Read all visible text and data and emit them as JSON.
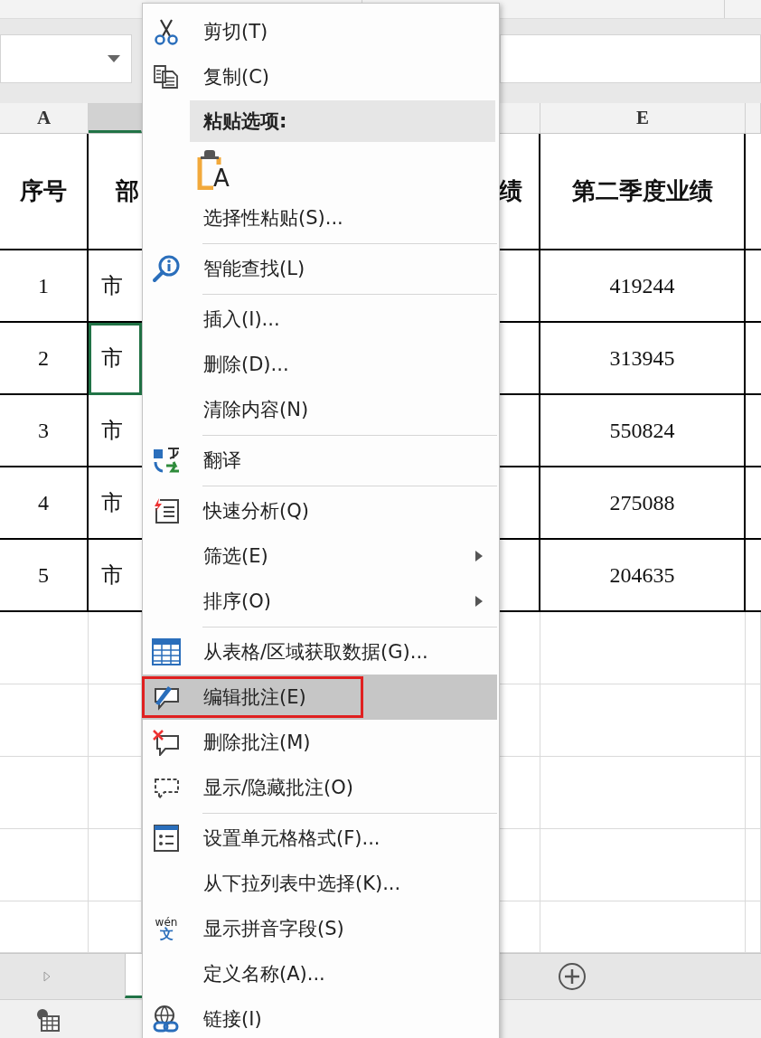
{
  "sheet": {
    "columns": [
      {
        "label": "A",
        "selected": false
      },
      {
        "selected": true
      },
      {
        "selected": false
      },
      {
        "label": "E",
        "selected": false
      },
      {
        "selected": false
      }
    ],
    "header_row": {
      "a": "序号",
      "b": "部",
      "d": "绩",
      "e": "第二季度业绩"
    },
    "rows": [
      {
        "a": "1",
        "b": "市",
        "e": "419244",
        "selected": false
      },
      {
        "a": "2",
        "b": "市",
        "e": "313945",
        "selected": true
      },
      {
        "a": "3",
        "b": "市",
        "e": "550824",
        "selected": false
      },
      {
        "a": "4",
        "b": "市",
        "e": "275088",
        "selected": false
      },
      {
        "a": "5",
        "b": "市",
        "e": "204635",
        "selected": false
      }
    ]
  },
  "context_menu": {
    "items": [
      {
        "kind": "item",
        "label": "剪切(T)",
        "submenu": false,
        "selected": false,
        "outlined": false
      },
      {
        "kind": "item",
        "label": "复制(C)",
        "submenu": false,
        "selected": false,
        "outlined": false
      },
      {
        "kind": "header",
        "label": "粘贴选项:"
      },
      {
        "kind": "paste-options",
        "glyph": "A"
      },
      {
        "kind": "item",
        "label": "选择性粘贴(S)...",
        "submenu": false,
        "selected": false,
        "outlined": false
      },
      {
        "kind": "separator"
      },
      {
        "kind": "item",
        "label": "智能查找(L)",
        "submenu": false,
        "selected": false,
        "outlined": false
      },
      {
        "kind": "separator"
      },
      {
        "kind": "item",
        "label": "插入(I)...",
        "submenu": false,
        "selected": false,
        "outlined": false
      },
      {
        "kind": "item",
        "label": "删除(D)...",
        "submenu": false,
        "selected": false,
        "outlined": false
      },
      {
        "kind": "item",
        "label": "清除内容(N)",
        "submenu": false,
        "selected": false,
        "outlined": false
      },
      {
        "kind": "separator"
      },
      {
        "kind": "item",
        "label": "翻译",
        "submenu": false,
        "selected": false,
        "outlined": false
      },
      {
        "kind": "separator"
      },
      {
        "kind": "item",
        "label": "快速分析(Q)",
        "submenu": false,
        "selected": false,
        "outlined": false
      },
      {
        "kind": "item",
        "label": "筛选(E)",
        "submenu": true,
        "selected": false,
        "outlined": false
      },
      {
        "kind": "item",
        "label": "排序(O)",
        "submenu": true,
        "selected": false,
        "outlined": false
      },
      {
        "kind": "separator"
      },
      {
        "kind": "item",
        "label": "从表格/区域获取数据(G)...",
        "submenu": false,
        "selected": false,
        "outlined": false
      },
      {
        "kind": "item",
        "label": "编辑批注(E)",
        "submenu": false,
        "selected": true,
        "outlined": true
      },
      {
        "kind": "item",
        "label": "删除批注(M)",
        "submenu": false,
        "selected": false,
        "outlined": false
      },
      {
        "kind": "item",
        "label": "显示/隐藏批注(O)",
        "submenu": false,
        "selected": false,
        "outlined": false
      },
      {
        "kind": "separator"
      },
      {
        "kind": "item",
        "label": "设置单元格格式(F)...",
        "submenu": false,
        "selected": false,
        "outlined": false
      },
      {
        "kind": "item",
        "label": "从下拉列表中选择(K)...",
        "submenu": false,
        "selected": false,
        "outlined": false
      },
      {
        "kind": "item",
        "label": "显示拼音字段(S)",
        "submenu": false,
        "selected": false,
        "outlined": false,
        "icon_glyphs": [
          "wén",
          "文"
        ]
      },
      {
        "kind": "item",
        "label": "定义名称(A)...",
        "submenu": false,
        "selected": false,
        "outlined": false
      },
      {
        "kind": "item",
        "label": "链接(I)",
        "submenu": false,
        "selected": false,
        "outlined": false
      }
    ]
  }
}
